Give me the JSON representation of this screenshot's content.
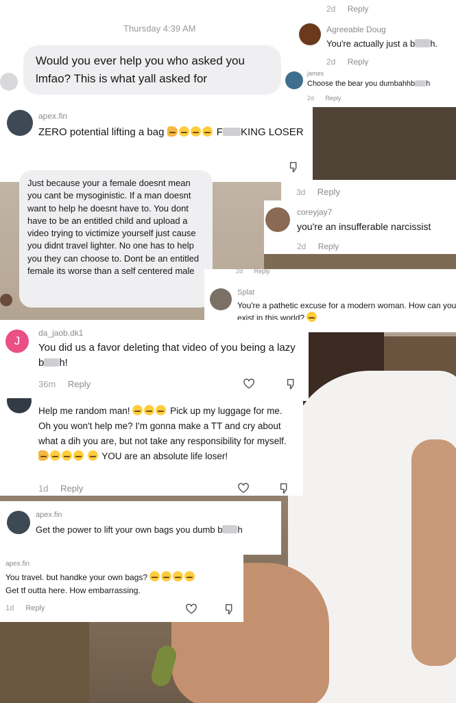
{
  "header": {
    "timestamp": "Thursday 4:39 AM"
  },
  "message_bubble": {
    "text": "Would you ever help you who asked you lmfao? This is what yall asked for"
  },
  "comments": {
    "agreeable_doug": {
      "top_meta": "2d",
      "top_reply": "Reply",
      "name": "Agreeable Doug",
      "text_a": "You're actually just a b",
      "text_b": "h.",
      "meta": "2d",
      "reply": "Reply"
    },
    "james": {
      "name": "james",
      "text_a": "Choose the bear you dumbahhb",
      "text_b": "h",
      "meta": "2d",
      "reply": "Reply"
    },
    "apex_fin_1": {
      "name": "apex.fin",
      "text_a": "ZERO potential lifting a bag",
      "text_b": "F",
      "text_c": "KING LOSER"
    },
    "reply_block": {
      "meta": "3d",
      "reply": "Reply"
    },
    "coreyjay7": {
      "name": "coreyjay7",
      "text": "you're an insufferable narcissist",
      "meta": "2d",
      "reply": "Reply"
    },
    "long_gray": {
      "text": "Just because your a female doesnt mean you cant be mysoginistic. If a man doesnt want to help he doesnt have to. You dont have to be an entitled child and upload a video trying to victimize yourself just cause you didnt travel lighter. No one has to help you they can choose to. Dont be an entitled female its worse than a self centered male"
    },
    "splat": {
      "cut_meta": "2d",
      "cut_reply": "Reply",
      "name": "Splat",
      "text": "You're a pathetic excuse for a modern woman. How can you exist in this world?"
    },
    "da_jaob": {
      "avatar_letter": "J",
      "name": "da_jaob.dk1",
      "text_a": "You did us a favor deleting that video of you being a lazy b",
      "text_b": "h!",
      "meta": "36m",
      "reply": "Reply"
    },
    "random_man": {
      "text_a": "Help me random man!",
      "text_b": "Pick up my luggage for me. Oh you won't help me? I'm gonna make a TT and cry about what a dih you are, but not take any responsibility for myself.",
      "text_c": "YOU are an absolute life loser!",
      "meta": "1d",
      "reply": "Reply"
    },
    "apex_fin_2": {
      "name": "apex.fin",
      "text_a": "Get the power to lift your own bags you dumb",
      "text_b": "b",
      "text_c": "h"
    },
    "apex_fin_3": {
      "name": "apex.fin",
      "text_a": "You travel. but handke your own bags?",
      "text_b": "Get tf outta here. How embarrassing.",
      "meta": "1d",
      "reply": "Reply"
    }
  }
}
